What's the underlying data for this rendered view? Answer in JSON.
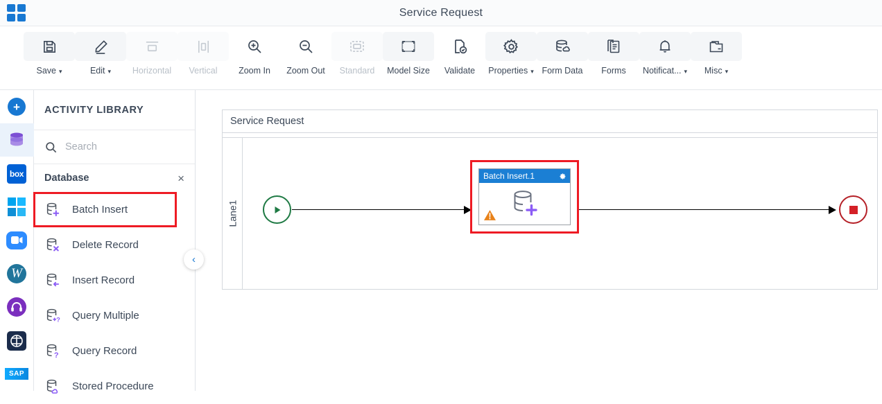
{
  "window": {
    "title": "Service Request",
    "app_icon": "grid-apps-icon"
  },
  "toolbar": {
    "items": [
      {
        "label": "Save",
        "icon": "save-icon",
        "caret": "⌄",
        "disabled": false
      },
      {
        "label": "Edit",
        "icon": "edit-pencil-icon",
        "caret": "⌄",
        "disabled": false
      },
      {
        "label": "Horizontal",
        "icon": "horizontal-align-icon",
        "caret": "",
        "disabled": true
      },
      {
        "label": "Vertical",
        "icon": "vertical-align-icon",
        "caret": "",
        "disabled": true
      },
      {
        "label": "Zoom In",
        "icon": "zoom-in-icon",
        "caret": "",
        "disabled": false
      },
      {
        "label": "Zoom Out",
        "icon": "zoom-out-icon",
        "caret": "",
        "disabled": false
      },
      {
        "label": "Standard",
        "icon": "standard-size-icon",
        "caret": "",
        "disabled": true
      },
      {
        "label": "Model Size",
        "icon": "model-size-icon",
        "caret": "",
        "disabled": false
      },
      {
        "label": "Validate",
        "icon": "validate-icon",
        "caret": "",
        "disabled": false
      },
      {
        "label": "Properties",
        "icon": "gear-icon",
        "caret": "⌄",
        "disabled": false
      },
      {
        "label": "Form Data",
        "icon": "form-data-icon",
        "caret": "",
        "disabled": false
      },
      {
        "label": "Forms",
        "icon": "forms-icon",
        "caret": "",
        "disabled": false
      },
      {
        "label": "Notificat...",
        "icon": "bell-icon",
        "caret": "⌄",
        "disabled": false
      },
      {
        "label": "Misc",
        "icon": "misc-folder-icon",
        "caret": "⌄",
        "disabled": false
      }
    ]
  },
  "rail": {
    "items": [
      {
        "name": "add-connector-button",
        "icon": "plus-icon",
        "active": false
      },
      {
        "name": "database-connector",
        "icon": "database-icon",
        "active": true
      },
      {
        "name": "box-connector",
        "icon": "box-icon",
        "label": "box",
        "active": false
      },
      {
        "name": "windows-connector",
        "icon": "windows-icon",
        "active": false
      },
      {
        "name": "zoom-connector",
        "icon": "zoom-video-icon",
        "active": false
      },
      {
        "name": "wordpress-connector",
        "icon": "wordpress-icon",
        "label": "W",
        "active": false
      },
      {
        "name": "support-connector",
        "icon": "headset-icon",
        "active": false
      },
      {
        "name": "tools-connector",
        "icon": "dark-circle-icon",
        "active": false
      },
      {
        "name": "sap-connector",
        "icon": "sap-icon",
        "label": "SAP",
        "active": false
      }
    ]
  },
  "panel": {
    "title": "ACTIVITY LIBRARY",
    "search": {
      "value": "",
      "placeholder": "Search",
      "icon": "search-icon"
    },
    "group": {
      "name": "Database",
      "close_icon": "×"
    },
    "activities": [
      {
        "label": "Batch Insert",
        "icon": "database-plus-icon",
        "badge": "+",
        "highlighted": true
      },
      {
        "label": "Delete Record",
        "icon": "database-delete-icon",
        "badge": "x",
        "highlighted": false
      },
      {
        "label": "Insert Record",
        "icon": "database-insert-icon",
        "badge": "←",
        "highlighted": false
      },
      {
        "label": "Query Multiple",
        "icon": "database-query-multi-icon",
        "badge": "+?",
        "highlighted": false
      },
      {
        "label": "Query Record",
        "icon": "database-query-icon",
        "badge": "?",
        "highlighted": false
      },
      {
        "label": "Stored Procedure",
        "icon": "database-procedure-icon",
        "badge": "",
        "highlighted": false
      }
    ],
    "collapse_icon": "‹"
  },
  "canvas": {
    "pool_title": "Service Request",
    "lane_label": "Lane1",
    "start_node": {
      "name": "start-event",
      "icon": "play-icon"
    },
    "task": {
      "title": "Batch Insert.1",
      "gear_icon": "gear-icon",
      "warning_icon": "warning-triangle-icon",
      "body_icon": "database-plus-icon",
      "highlighted": true
    },
    "end_node": {
      "name": "end-event",
      "icon": "stop-square-icon"
    }
  },
  "colors": {
    "accent_blue": "#1878d2",
    "task_header": "#1b7fd4",
    "highlight_red": "#ee1b24",
    "start_green": "#1f7a44",
    "end_red": "#b52027",
    "warning_orange": "#e8821a",
    "db_purple": "#8b5cf6",
    "rail_active_bg": "#eaf2fb"
  }
}
